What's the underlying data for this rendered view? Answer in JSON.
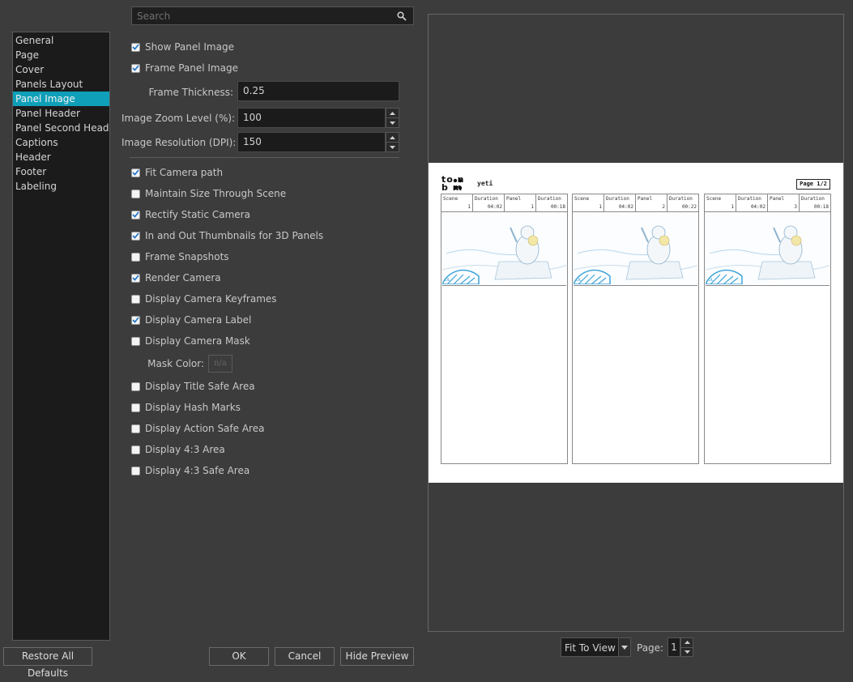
{
  "search": {
    "placeholder": "Search"
  },
  "categories": [
    {
      "label": "General"
    },
    {
      "label": "Page"
    },
    {
      "label": "Cover"
    },
    {
      "label": "Panels Layout"
    },
    {
      "label": "Panel Image",
      "selected": true
    },
    {
      "label": "Panel Header"
    },
    {
      "label": "Panel Second Header"
    },
    {
      "label": "Captions"
    },
    {
      "label": "Header"
    },
    {
      "label": "Footer"
    },
    {
      "label": "Labeling"
    }
  ],
  "options": {
    "show_panel_image": {
      "label": "Show Panel Image",
      "checked": true
    },
    "frame_panel_image": {
      "label": "Frame Panel Image",
      "checked": true
    },
    "frame_thickness": {
      "label": "Frame Thickness:",
      "value": "0.25"
    },
    "image_zoom": {
      "label": "Image Zoom Level (%):",
      "value": "100"
    },
    "image_resolution": {
      "label": "Image Resolution (DPI):",
      "value": "150"
    },
    "fit_camera_path": {
      "label": "Fit Camera path",
      "checked": true
    },
    "maintain_size": {
      "label": "Maintain Size Through Scene",
      "checked": false
    },
    "rectify_static": {
      "label": "Rectify Static Camera",
      "checked": true
    },
    "in_out_thumbs": {
      "label": "In and Out Thumbnails for 3D Panels",
      "checked": true
    },
    "frame_snapshots": {
      "label": "Frame Snapshots",
      "checked": false
    },
    "render_camera": {
      "label": "Render Camera",
      "checked": true
    },
    "display_keyframes": {
      "label": "Display Camera Keyframes",
      "checked": false
    },
    "display_label": {
      "label": "Display Camera Label",
      "checked": true
    },
    "display_mask": {
      "label": "Display Camera Mask",
      "checked": false
    },
    "mask_color": {
      "label": "Mask Color:",
      "value": "n/a"
    },
    "title_safe": {
      "label": "Display Title Safe Area",
      "checked": false
    },
    "hash_marks": {
      "label": "Display Hash Marks",
      "checked": false
    },
    "action_safe": {
      "label": "Display Action Safe Area",
      "checked": false
    },
    "area_43": {
      "label": "Display 4:3 Area",
      "checked": false
    },
    "safe_43": {
      "label": "Display 4:3 Safe Area",
      "checked": false
    }
  },
  "buttons": {
    "restore": "Restore All Defaults",
    "ok": "OK",
    "cancel": "Cancel",
    "hide_preview": "Hide Preview"
  },
  "preview": {
    "logo_top": "to n",
    "logo_bottom": "b  m",
    "project": "yeti",
    "page_indicator": "Page 1/2",
    "panels": [
      {
        "scene_label": "Scene",
        "scene": "1",
        "dur_label": "Duration",
        "dur": "04:02",
        "panel_label": "Panel",
        "panel": "1",
        "pdur_label": "Duration",
        "pdur": "00:18"
      },
      {
        "scene_label": "Scene",
        "scene": "1",
        "dur_label": "Duration",
        "dur": "04:02",
        "panel_label": "Panel",
        "panel": "2",
        "pdur_label": "Duration",
        "pdur": "00:22"
      },
      {
        "scene_label": "Scene",
        "scene": "1",
        "dur_label": "Duration",
        "dur": "04:02",
        "panel_label": "Panel",
        "panel": "3",
        "pdur_label": "Duration",
        "pdur": "00:18"
      }
    ],
    "fit_mode": "Fit To View",
    "page_label": "Page:",
    "page_value": "1"
  },
  "colors": {
    "accent": "#0f9fb8",
    "check": "#1a72c8",
    "panel_bg": "#3c3c3c"
  }
}
